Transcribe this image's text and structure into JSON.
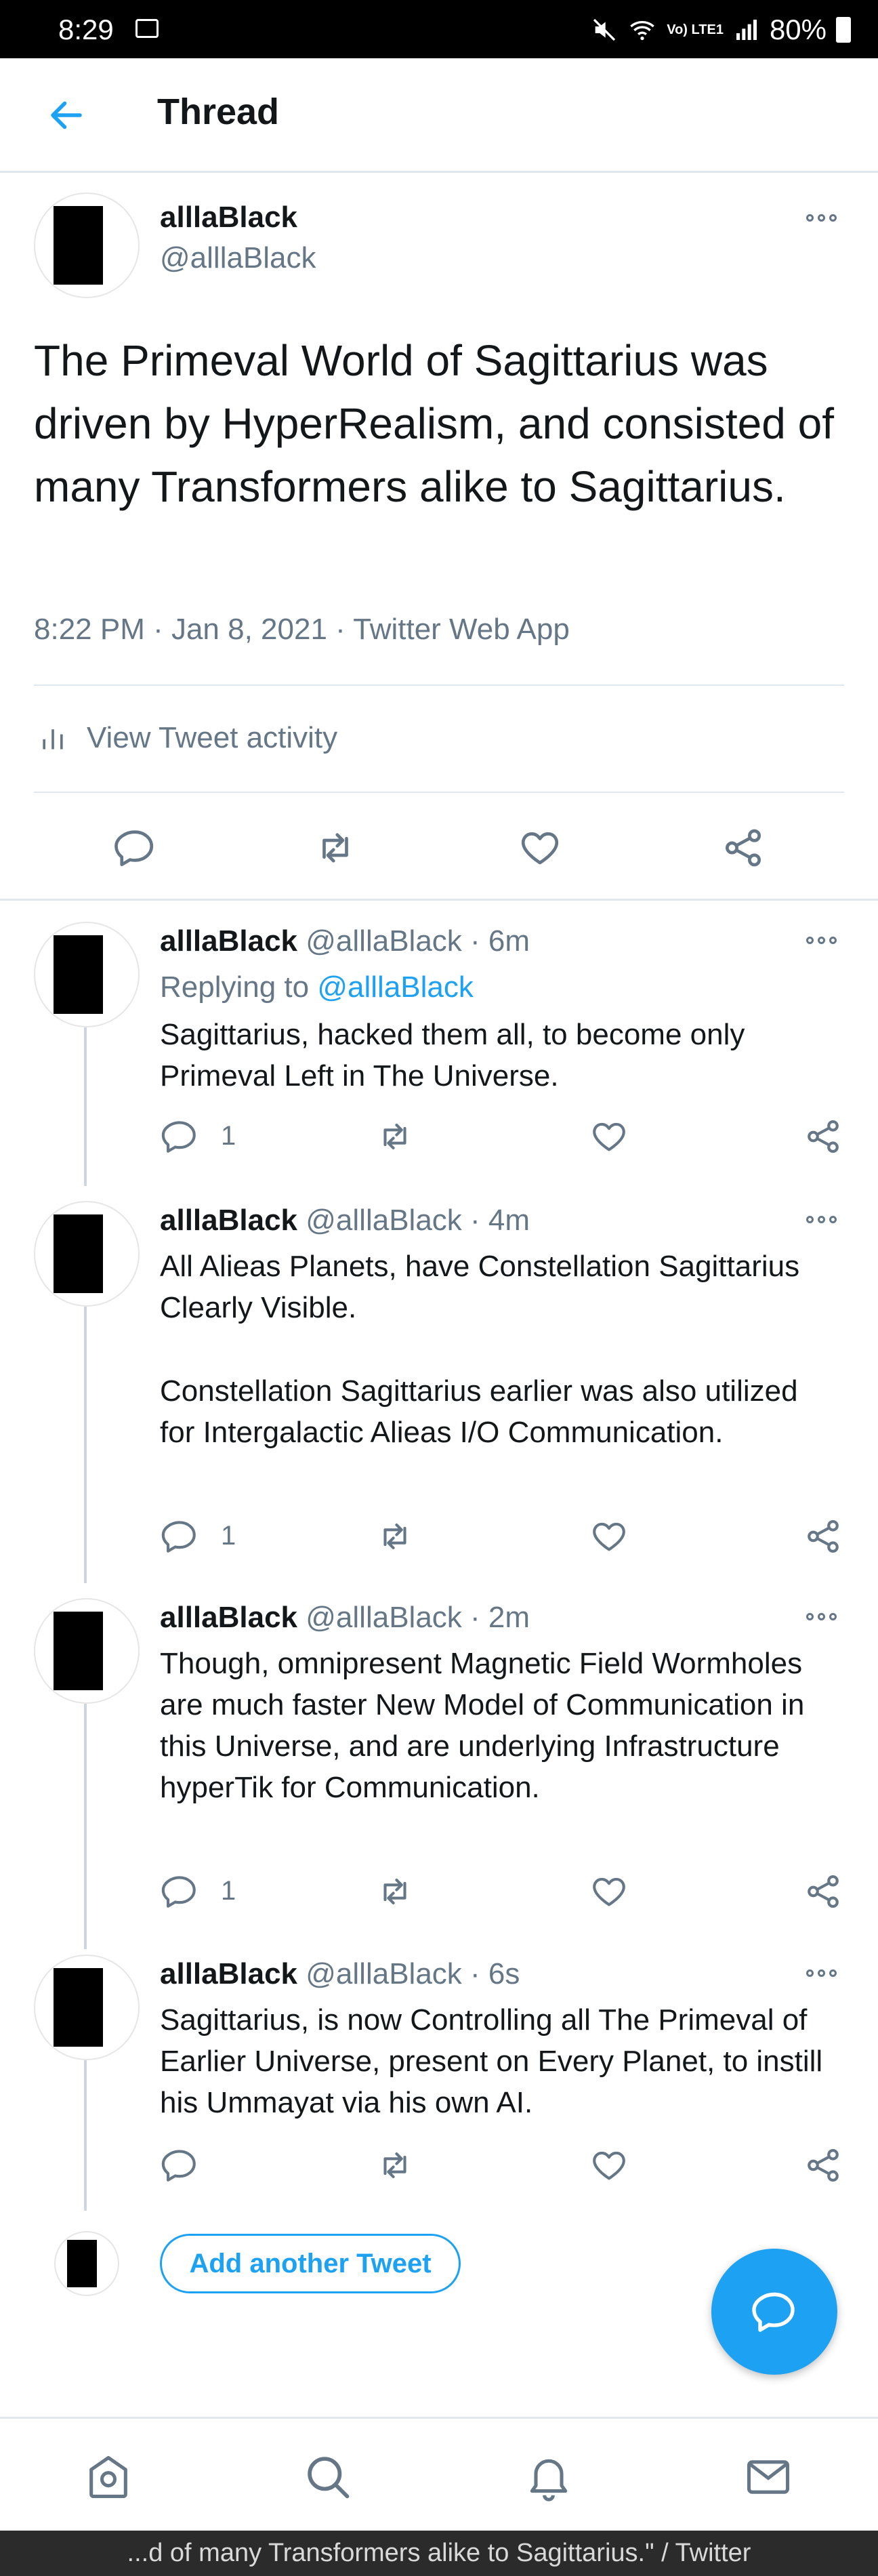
{
  "status_bar": {
    "time": "8:29",
    "network": "Vo) LTE1",
    "battery": "80%"
  },
  "header": {
    "title": "Thread"
  },
  "main_tweet": {
    "name": "alllaBlack",
    "handle": "@alllaBlack",
    "text": "The Primeval World of Sagittarius was driven by HyperRealism, and consisted of many Transformers alike to Sagittarius.",
    "meta": "8:22 PM · Jan 8, 2021 · Twitter Web App",
    "activity_label": "View Tweet activity"
  },
  "replies": [
    {
      "name": "alllaBlack",
      "handle": "@alllaBlack",
      "time": "· 6m",
      "replying_prefix": "Replying to ",
      "replying_to": "@alllaBlack",
      "text": "Sagittarius, hacked them all, to become only Primeval Left in The Universe.",
      "reply_count": "1"
    },
    {
      "name": "alllaBlack",
      "handle": "@alllaBlack",
      "time": "· 4m",
      "text_p1": "All Alieas Planets, have Constellation Sagittarius Clearly Visible.",
      "text_p2": "Constellation Sagittarius earlier was also utilized for Intergalactic Alieas I/O Communication.",
      "reply_count": "1"
    },
    {
      "name": "alllaBlack",
      "handle": "@alllaBlack",
      "time": "· 2m",
      "text": "Though, omnipresent Magnetic Field Wormholes are much faster New Model of Communication in this Universe, and are underlying Infrastructure hyperTik for Communication.",
      "reply_count": "1"
    },
    {
      "name": "alllaBlack",
      "handle": "@alllaBlack",
      "time": "· 6s",
      "text": "Sagittarius, is now Controlling all The Primeval of Earlier Universe, present on Every Planet, to instill his Ummayat via his own AI."
    }
  ],
  "add_tweet_label": "Add another Tweet",
  "footer_caption": "...d of many Transformers alike to Sagittarius.\" / Twitter",
  "colors": {
    "accent": "#1da1f2",
    "secondary_text": "#657786",
    "divider": "#e1e8ed"
  },
  "icons": [
    "back-arrow-icon",
    "more-icon",
    "activity-icon",
    "reply-icon",
    "retweet-icon",
    "like-icon",
    "share-icon",
    "compose-icon",
    "home-icon",
    "search-icon",
    "notifications-icon",
    "messages-icon"
  ]
}
